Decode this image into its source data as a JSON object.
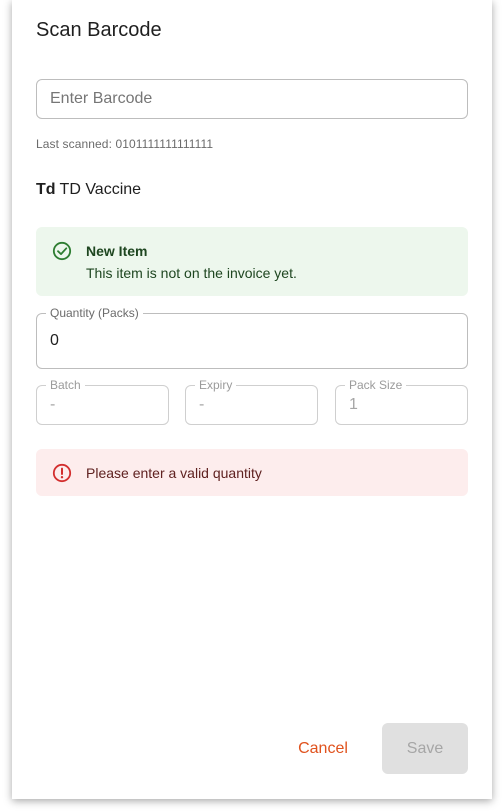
{
  "dialog": {
    "title": "Scan Barcode"
  },
  "barcode": {
    "placeholder": "Enter Barcode",
    "value": "",
    "last_scanned": "Last scanned: 0101111111111111"
  },
  "item": {
    "code": "Td",
    "name": "TD Vaccine"
  },
  "success_alert": {
    "icon": "check-circle-icon",
    "color": "#2e7d32",
    "heading": "New Item",
    "message": "This item is not on the invoice yet."
  },
  "fields": {
    "quantity": {
      "label": "Quantity (Packs)",
      "value": "0"
    },
    "batch": {
      "label": "Batch",
      "value": "-"
    },
    "expiry": {
      "label": "Expiry",
      "value": "-"
    },
    "pack_size": {
      "label": "Pack Size",
      "value": "1"
    }
  },
  "error_alert": {
    "icon": "error-icon",
    "color": "#d32f2f",
    "message": "Please enter a valid quantity"
  },
  "actions": {
    "cancel_label": "Cancel",
    "save_label": "Save",
    "cancel_color": "#e0521d"
  }
}
